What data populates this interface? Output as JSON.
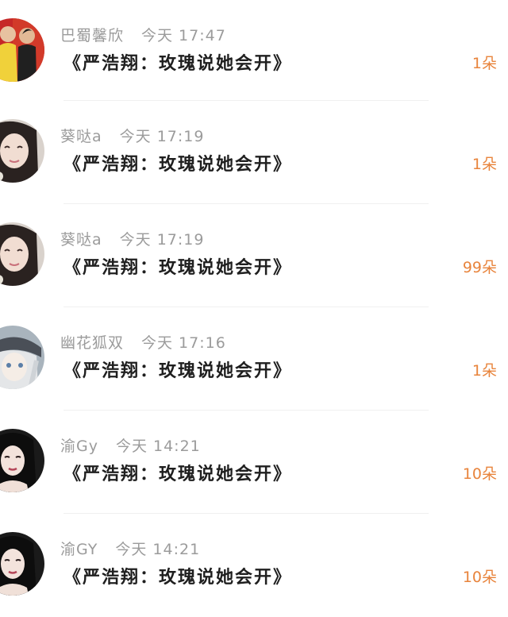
{
  "items": [
    {
      "username": "巴蜀馨欣",
      "time": "今天 17:47",
      "title": "《严浩翔：玫瑰说她会开》",
      "gift": "1朵",
      "avatar": "two-men-photo"
    },
    {
      "username": "葵哒a",
      "time": "今天 17:19",
      "title": "《严浩翔：玫瑰说她会开》",
      "gift": "1朵",
      "avatar": "girl-photo"
    },
    {
      "username": "葵哒a",
      "time": "今天 17:19",
      "title": "《严浩翔：玫瑰说她会开》",
      "gift": "99朵",
      "avatar": "girl-photo"
    },
    {
      "username": "幽花狐双",
      "time": "今天 17:16",
      "title": "《严浩翔：玫瑰说她会开》",
      "gift": "1朵",
      "avatar": "anime-character"
    },
    {
      "username": "渝Gy",
      "time": "今天 14:21",
      "title": "《严浩翔：玫瑰说她会开》",
      "gift": "10朵",
      "avatar": "girl-dark-hair-photo"
    },
    {
      "username": "渝GY",
      "time": "今天 14:21",
      "title": "《严浩翔：玫瑰说她会开》",
      "gift": "10朵",
      "avatar": "girl-dark-hair-photo"
    }
  ]
}
